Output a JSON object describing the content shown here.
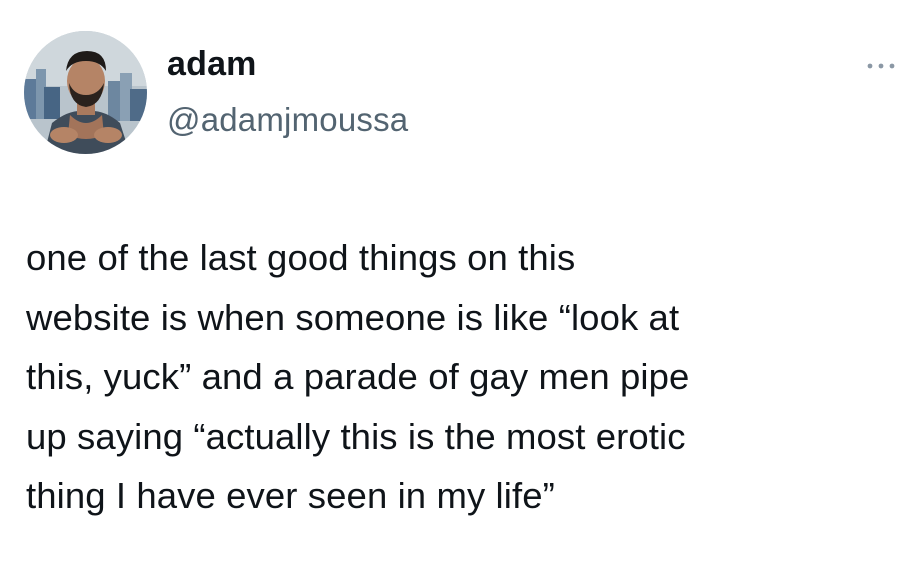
{
  "tweet": {
    "author": {
      "display_name": "adam",
      "handle": "@adamjmoussa",
      "avatar_icon": "profile-photo"
    },
    "more_icon": "more-options-icon",
    "text": "one of the last good things on this\nwebsite is when someone is like “look at\nthis, yuck” and a parade of gay men pipe\nup saying “actually this is the most erotic\nthing I have ever seen in my life”"
  },
  "colors": {
    "text_primary": "#0f1419",
    "text_secondary": "#536471",
    "background": "#ffffff"
  }
}
